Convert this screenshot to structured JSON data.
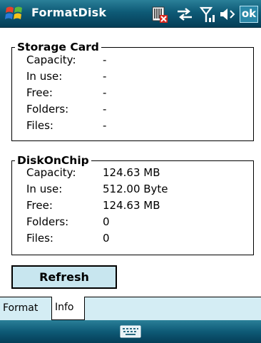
{
  "app": {
    "title": "FormatDisk",
    "ok_label": "ok"
  },
  "status_icons": [
    "sim-card-missing-icon",
    "sync-arrows-icon",
    "signal-strength-icon",
    "speaker-icon"
  ],
  "storage_card": {
    "title": "Storage Card",
    "rows": [
      {
        "label": "Capacity:",
        "value": "-"
      },
      {
        "label": "In use:",
        "value": "-"
      },
      {
        "label": "Free:",
        "value": "-"
      },
      {
        "label": "Folders:",
        "value": "-"
      },
      {
        "label": "Files:",
        "value": "-"
      }
    ]
  },
  "disk_on_chip": {
    "title": "DiskOnChip",
    "rows": [
      {
        "label": "Capacity:",
        "value": "124.63 MB"
      },
      {
        "label": "In use:",
        "value": "512.00 Byte"
      },
      {
        "label": "Free:",
        "value": "124.63 MB"
      },
      {
        "label": "Folders:",
        "value": "0"
      },
      {
        "label": "Files:",
        "value": "0"
      }
    ]
  },
  "refresh_label": "Refresh",
  "tabs": [
    {
      "label": "Format",
      "selected": false
    },
    {
      "label": "Info",
      "selected": true
    }
  ],
  "colors": {
    "titlebar": "#0e5a76",
    "button_fill": "#c8e6ef",
    "tab_strip": "#d4edf4"
  }
}
